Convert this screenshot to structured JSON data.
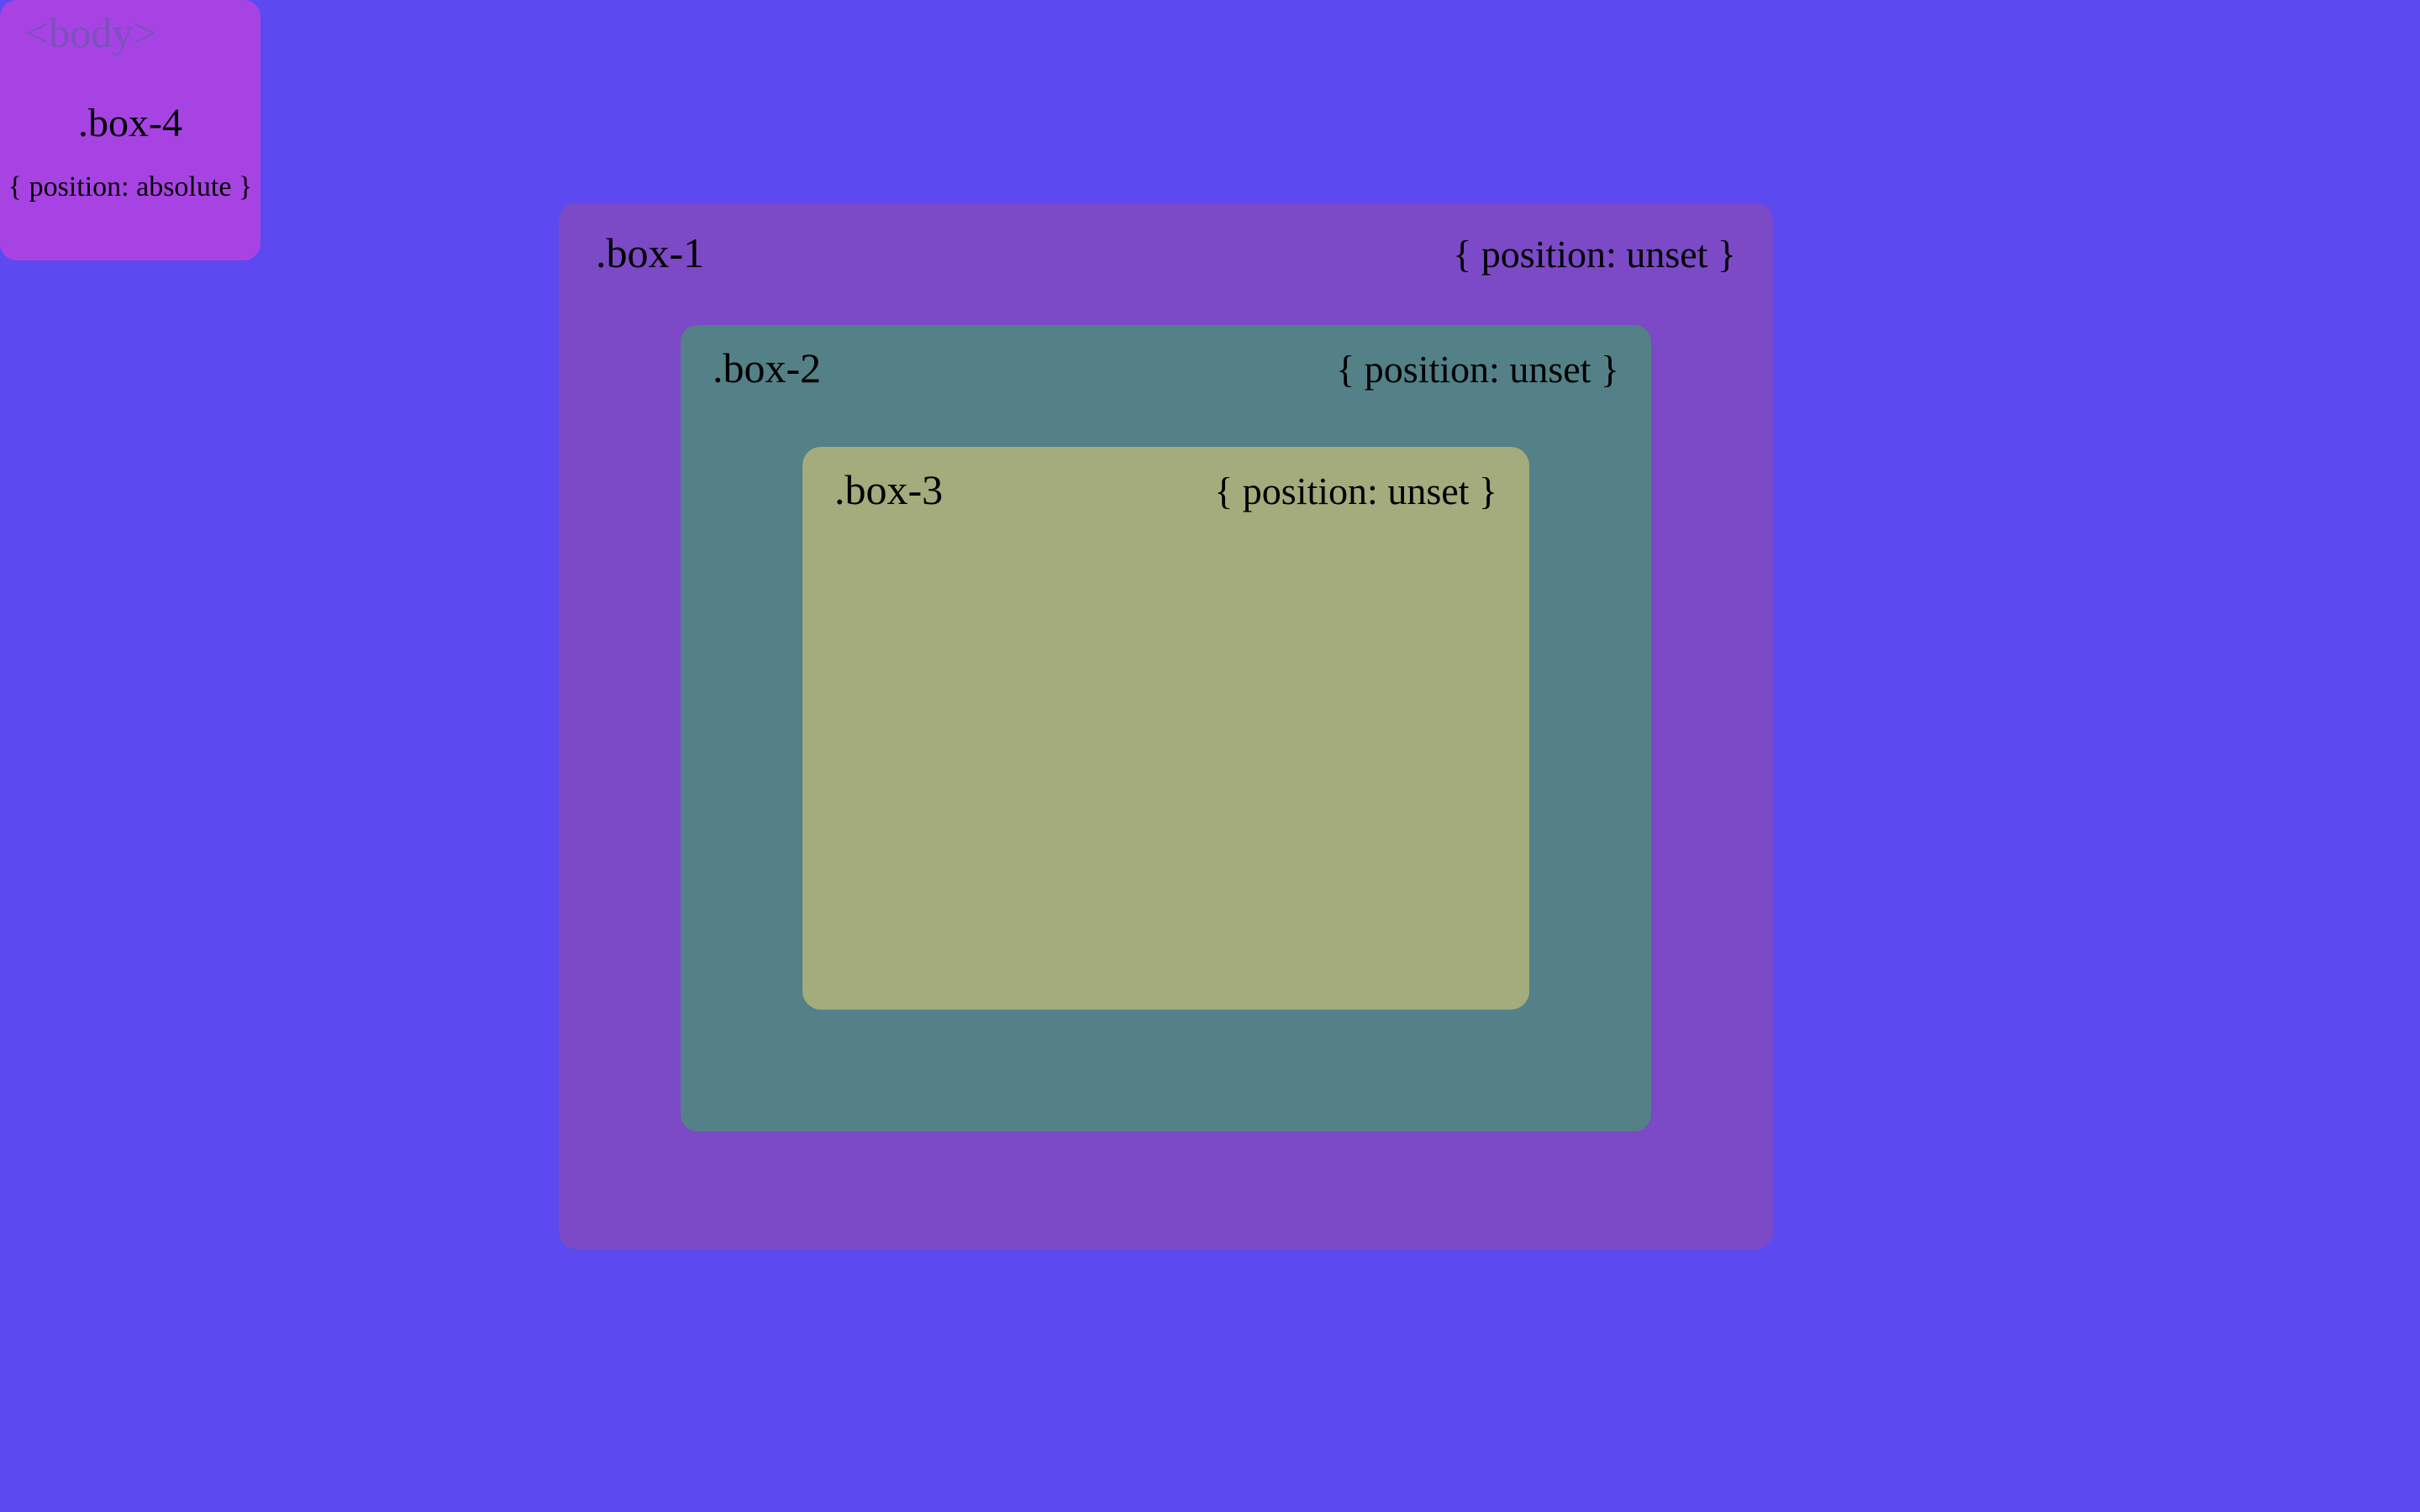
{
  "bodyLabel": "<body>",
  "boxes": {
    "box4": {
      "name": ".box-4",
      "position": "{ position: absolute }"
    },
    "box1": {
      "name": ".box-1",
      "position": "{ position: unset }"
    },
    "box2": {
      "name": ".box-2",
      "position": "{ position: unset }"
    },
    "box3": {
      "name": ".box-3",
      "position": "{ position: unset }"
    }
  },
  "colors": {
    "background": "#5d49f0",
    "box4": "#a843e3",
    "box1": "#7c49c7",
    "box2": "#548087",
    "box3": "#a4ab7c"
  }
}
